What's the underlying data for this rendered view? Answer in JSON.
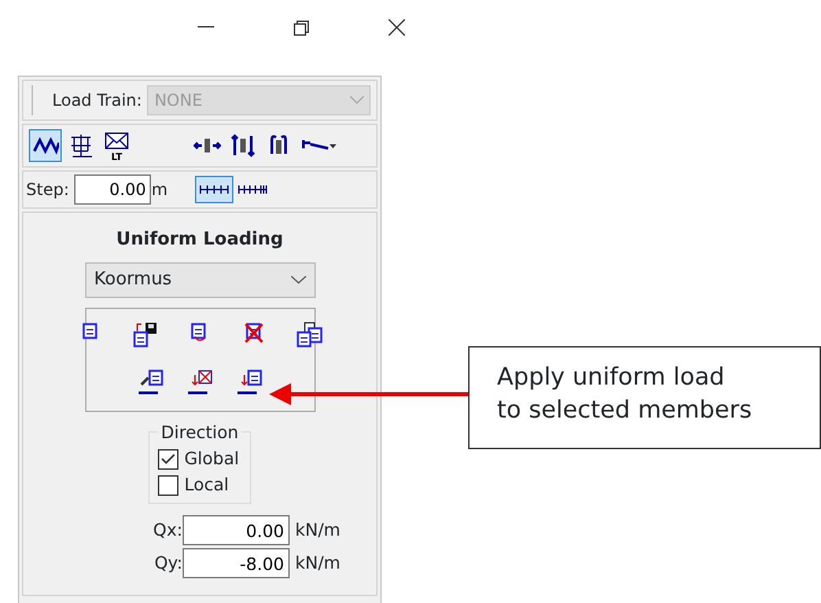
{
  "load_train": {
    "label": "Load Train:",
    "value": "NONE",
    "disabled": true
  },
  "toolbar": [
    {
      "kind": "zigzag",
      "selected": true
    },
    {
      "kind": "grid",
      "selected": false
    },
    {
      "kind": "envelope",
      "selected": false,
      "caption": "LT"
    },
    {
      "kind": "horiz",
      "selected": false
    },
    {
      "kind": "vert",
      "selected": false
    },
    {
      "kind": "rotate",
      "selected": false
    },
    {
      "kind": "beam",
      "selected": false
    }
  ],
  "step": {
    "label": "Step:",
    "value": "0.00",
    "unit": "m",
    "modes": [
      {
        "selected": true
      },
      {
        "selected": false
      }
    ]
  },
  "uniform": {
    "title": "Uniform Loading",
    "preset": "Koormus",
    "direction": {
      "title": "Direction",
      "options": [
        {
          "label": "Global",
          "checked": true
        },
        {
          "label": "Local",
          "checked": false
        }
      ]
    },
    "fields": [
      {
        "label": "Qx:",
        "value": "0.00",
        "unit": "kN/m"
      },
      {
        "label": "Qy:",
        "value": "-8.00",
        "unit": "kN/m"
      }
    ]
  },
  "callout": {
    "lines": [
      "Apply uniform load",
      "to selected members"
    ]
  }
}
